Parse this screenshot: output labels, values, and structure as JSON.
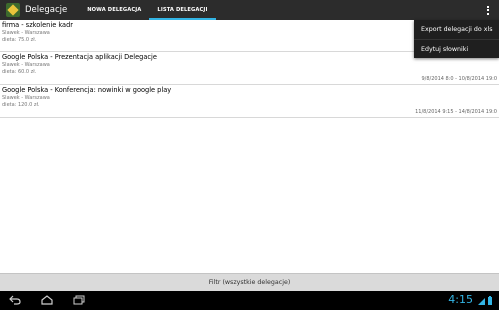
{
  "app": {
    "title": "Delegacje",
    "tabs": [
      {
        "label": "NOWA DELEGACJA",
        "active": false
      },
      {
        "label": "LISTA DELEGACJI",
        "active": true
      }
    ],
    "accent_color": "#33b5e5"
  },
  "list": {
    "items": [
      {
        "title": "firma - szkolenie kadr",
        "person": "Slawek - Warszawa",
        "diet": "dieta: 75.0 zł.",
        "dates": ""
      },
      {
        "title": "Google Polska - Prezentacja aplikacji Delegacje",
        "person": "Slawek - Warszawa",
        "diet": "dieta: 60.0 zł.",
        "dates": "9/8/2014 8:0 - 10/8/2014 19:0"
      },
      {
        "title": "Google Polska - Konferencja: nowinki w google play",
        "person": "Slawek - Warszawa",
        "diet": "dieta: 120.0 zł.",
        "dates": "11/8/2014 9:15 - 14/8/2014 19:0"
      }
    ]
  },
  "menu": {
    "items": [
      "Export delegacji do xls",
      "Edytuj słowniki"
    ]
  },
  "filter": {
    "label": "Filtr (wszystkie delegacje)"
  },
  "system": {
    "clock": "4:15",
    "nav_icons": [
      "back-icon",
      "home-icon",
      "recent-apps-icon"
    ]
  }
}
